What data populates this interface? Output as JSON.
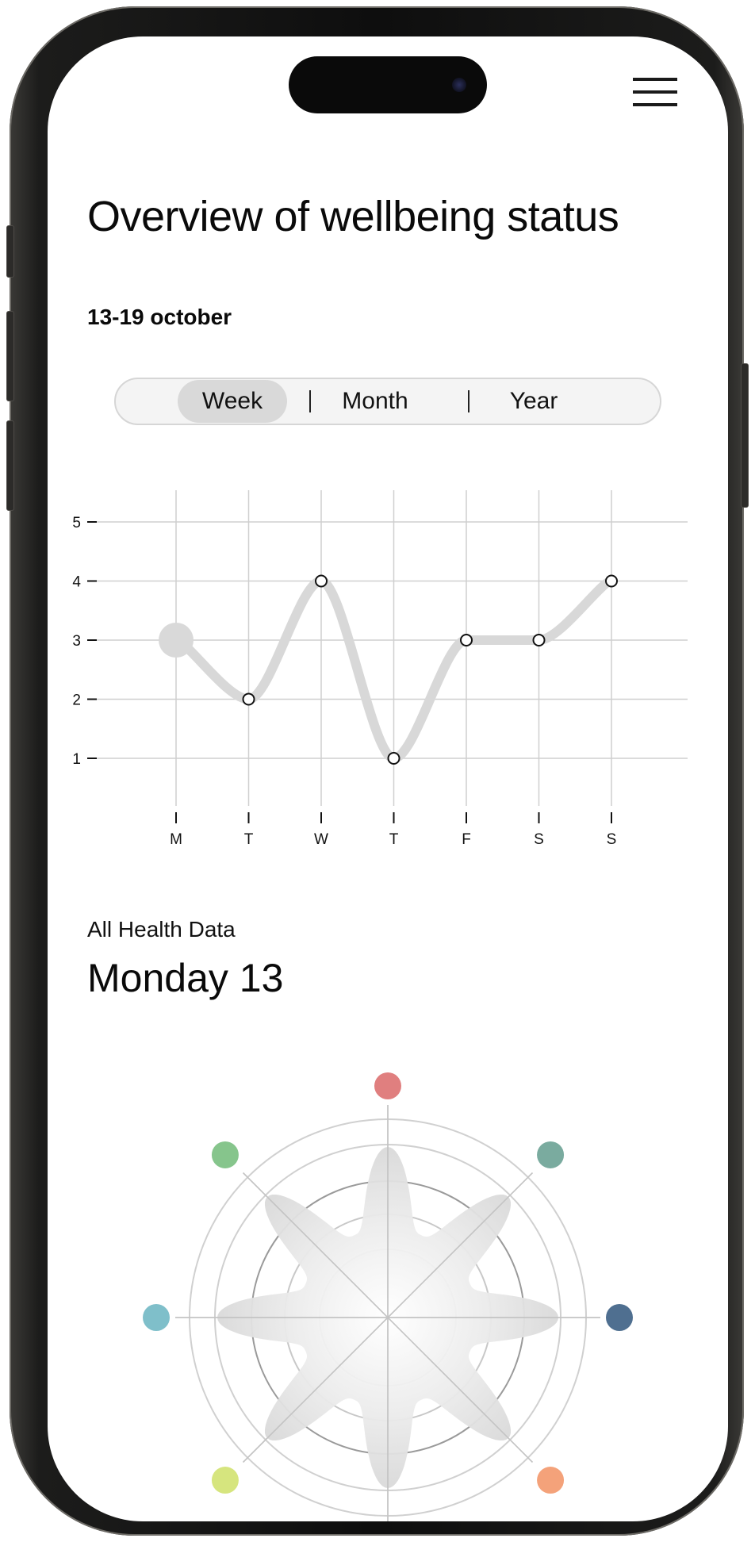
{
  "header": {
    "title": "Overview of wellbeing status",
    "date_range": "13-19 october"
  },
  "period_toggle": {
    "options": [
      "Week",
      "Month",
      "Year"
    ],
    "selected": "Week"
  },
  "chart_data": {
    "type": "line",
    "categories": [
      "M",
      "T",
      "W",
      "T",
      "F",
      "S",
      "S"
    ],
    "series": [
      {
        "values": [
          3,
          2,
          4,
          1,
          3,
          3,
          4
        ]
      }
    ],
    "y_ticks": [
      "5",
      "4",
      "3",
      "2",
      "1"
    ],
    "ylim": [
      1,
      5
    ],
    "grid": true,
    "line_color": "#d8d8d8",
    "highlighted_category_index": 0
  },
  "health_section": {
    "label": "All Health Data",
    "day": "Monday 13"
  },
  "radar": {
    "dots": [
      {
        "name": "top",
        "color": "#e07f7f"
      },
      {
        "name": "top-right",
        "color": "#7aab9f"
      },
      {
        "name": "right",
        "color": "#4f6f90"
      },
      {
        "name": "bottom-right",
        "color": "#f4a27a"
      },
      {
        "name": "bottom",
        "color": "#8b78b5"
      },
      {
        "name": "bottom-left",
        "color": "#d6e57e"
      },
      {
        "name": "left",
        "color": "#7fbfca"
      },
      {
        "name": "top-left",
        "color": "#86c58c"
      }
    ]
  },
  "icons": {
    "menu": "hamburger-menu-icon",
    "camera": "camera-icon"
  }
}
